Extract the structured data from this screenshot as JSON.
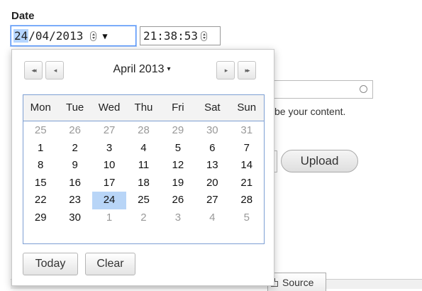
{
  "form": {
    "date_label": "Date",
    "date_day": "24",
    "date_rest": "/04/2013",
    "time_value": "21:38:53",
    "dropdown_glyph": "▼"
  },
  "background": {
    "description_fragment": "be your content.",
    "upload_label": "Upload",
    "source_tab_label": "Source"
  },
  "datepicker": {
    "nav": {
      "first": "◂◂",
      "prev": "◂",
      "next": "▸",
      "last": "▸▸"
    },
    "month_title": "April 2013",
    "month_caret": "▾",
    "weekdays": [
      "Mon",
      "Tue",
      "Wed",
      "Thu",
      "Fri",
      "Sat",
      "Sun"
    ],
    "weeks": [
      [
        "25",
        "26",
        "27",
        "28",
        "29",
        "30",
        "31"
      ],
      [
        "1",
        "2",
        "3",
        "4",
        "5",
        "6",
        "7"
      ],
      [
        "8",
        "9",
        "10",
        "11",
        "12",
        "13",
        "14"
      ],
      [
        "15",
        "16",
        "17",
        "18",
        "19",
        "20",
        "21"
      ],
      [
        "22",
        "23",
        "24",
        "25",
        "26",
        "27",
        "28"
      ],
      [
        "29",
        "30",
        "1",
        "2",
        "3",
        "4",
        "5"
      ]
    ],
    "today_label": "Today",
    "clear_label": "Clear"
  },
  "colors": {
    "selected_day_bg": "#b8d5f7",
    "grid_border": "#7d9fd3",
    "focus_ring": "#4d90fe"
  },
  "icons": {
    "spinner": "spin-updown-icon",
    "dropdown": "triangle-down-icon",
    "source": "document-icon",
    "radio": "circle-icon"
  }
}
